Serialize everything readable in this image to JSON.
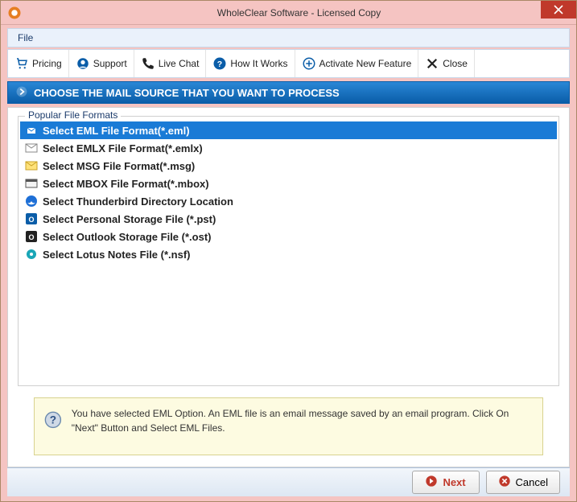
{
  "titlebar": {
    "title": "WholeClear Software - Licensed Copy"
  },
  "menubar": {
    "file": "File"
  },
  "toolbar": {
    "pricing": {
      "label": "Pricing",
      "icon": "cart-icon"
    },
    "support": {
      "label": "Support",
      "icon": "headset-icon"
    },
    "livechat": {
      "label": "Live Chat",
      "icon": "phone-icon"
    },
    "how": {
      "label": "How It Works",
      "icon": "question-icon"
    },
    "activate": {
      "label": "Activate New Feature",
      "icon": "plus-circle-icon"
    },
    "close": {
      "label": "Close",
      "icon": "x-icon"
    }
  },
  "section_header": "CHOOSE THE MAIL SOURCE THAT YOU WANT TO PROCESS",
  "fieldset_legend": "Popular File Formats",
  "options": [
    {
      "label": "Select EML File Format(*.eml)",
      "icon": "eml-icon",
      "selected": true
    },
    {
      "label": "Select EMLX File Format(*.emlx)",
      "icon": "emlx-icon",
      "selected": false
    },
    {
      "label": "Select MSG File Format(*.msg)",
      "icon": "msg-icon",
      "selected": false
    },
    {
      "label": "Select MBOX File Format(*.mbox)",
      "icon": "mbox-icon",
      "selected": false
    },
    {
      "label": "Select Thunderbird Directory Location",
      "icon": "thunderbird-icon",
      "selected": false
    },
    {
      "label": "Select Personal Storage File (*.pst)",
      "icon": "pst-icon",
      "selected": false
    },
    {
      "label": "Select Outlook Storage File (*.ost)",
      "icon": "ost-icon",
      "selected": false
    },
    {
      "label": "Select Lotus Notes File (*.nsf)",
      "icon": "nsf-icon",
      "selected": false
    }
  ],
  "info_text": "You have selected EML Option. An EML file is an email message saved by an email program. Click On \"Next\" Button and Select EML Files.",
  "footer": {
    "next": "Next",
    "cancel": "Cancel"
  }
}
